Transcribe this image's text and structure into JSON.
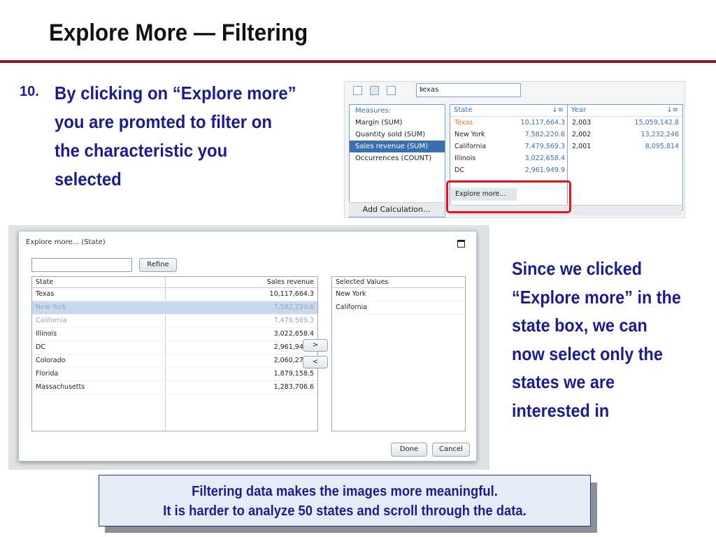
{
  "slide": {
    "title": "Explore More — Filtering",
    "step_number": "10.",
    "step_text": "By clicking on “Explore more” you are promted to filter on the characteristic you selected",
    "side_text": "Since we clicked “Explore more” in the state box, we can now select only the states we are interested in",
    "note_line1": "Filtering data makes the images more meaningful.",
    "note_line2": "It is harder to analyze 50 states and scroll through the data."
  },
  "toolbar": {
    "search_value": "texas",
    "clear_icon": "×"
  },
  "measures": {
    "header": "Measures:",
    "items": [
      "Margin (SUM)",
      "Quantity sold (SUM)",
      "Sales revenue (SUM)",
      "Occurrences (COUNT)"
    ],
    "selected_index": 2,
    "add_calculation": "Add Calculation..."
  },
  "state_box": {
    "header": "State",
    "rows": [
      {
        "label": "Texas",
        "value": "10,117,664.3"
      },
      {
        "label": "New York",
        "value": "7,582,220.6"
      },
      {
        "label": "California",
        "value": "7,479,569.3"
      },
      {
        "label": "Illinois",
        "value": "3,022,658.4"
      },
      {
        "label": "DC",
        "value": "2,961,949.9"
      }
    ],
    "menu_item": "Explore more..."
  },
  "year_box": {
    "header": "Year",
    "rows": [
      {
        "label": "2,003",
        "value": "15,059,142.8"
      },
      {
        "label": "2,002",
        "value": "13,232,246"
      },
      {
        "label": "2,001",
        "value": "8,095,814"
      }
    ]
  },
  "dialog": {
    "title": "Explore more... (State)",
    "refine_label": "Refine",
    "col_state": "State",
    "col_revenue": "Sales revenue",
    "rows": [
      {
        "state": "Texas",
        "revenue": "10,117,664.3"
      },
      {
        "state": "New York",
        "revenue": "7,582,220.6"
      },
      {
        "state": "California",
        "revenue": "7,479,569.3"
      },
      {
        "state": "Illinois",
        "revenue": "3,022,658.4"
      },
      {
        "state": "DC",
        "revenue": "2,961,949.9"
      },
      {
        "state": "Colorado",
        "revenue": "2,060,275.2"
      },
      {
        "state": "Florida",
        "revenue": "1,879,158.5"
      },
      {
        "state": "Massachusetts",
        "revenue": "1,283,706.6"
      }
    ],
    "selected_header": "Selected Values",
    "selected_values": [
      "New York",
      "California"
    ],
    "move_right": ">",
    "move_left": "<",
    "done_label": "Done",
    "cancel_label": "Cancel"
  },
  "colors": {
    "title_rule": "#8b1a1a",
    "text_blue": "#1c1c8c",
    "highlight": "#e8101a"
  }
}
